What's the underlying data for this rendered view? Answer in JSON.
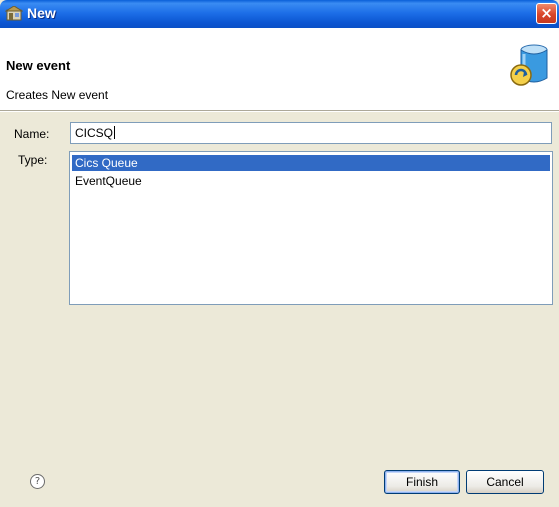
{
  "window": {
    "title": "New"
  },
  "banner": {
    "title": "New event",
    "description": "Creates New event"
  },
  "form": {
    "name_label": "Name:",
    "name_value": "CICSQ",
    "type_label": "Type:",
    "type_options": [
      "Cics Queue",
      "EventQueue"
    ],
    "selected_type": "Cics Queue"
  },
  "footer": {
    "help_icon": "?",
    "finish_label": "Finish",
    "cancel_label": "Cancel"
  },
  "titlebar": {
    "close_icon": "×"
  },
  "colors": {
    "accent": "#316ac5",
    "titlebar": "#0a5fd8",
    "close": "#d9452a"
  }
}
